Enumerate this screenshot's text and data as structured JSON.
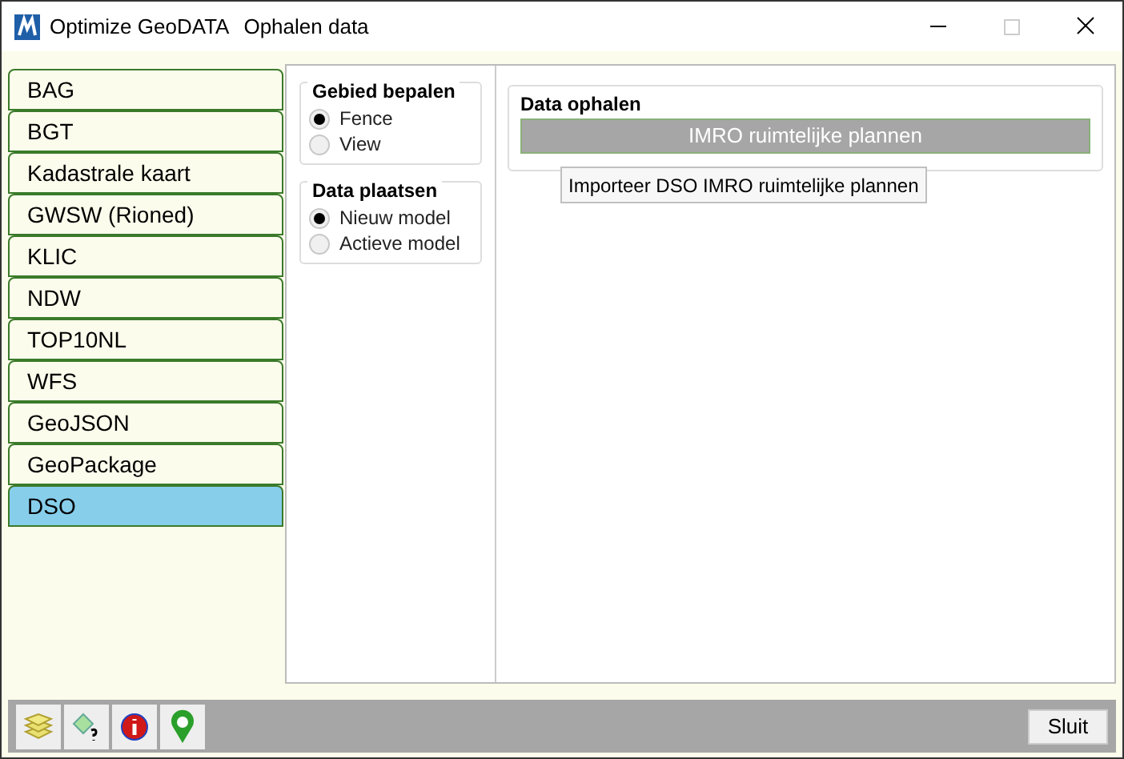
{
  "window": {
    "title": "Optimize GeoDATA",
    "subtitle": "Ophalen data"
  },
  "sidebar": {
    "items": [
      {
        "label": "BAG",
        "selected": false
      },
      {
        "label": "BGT",
        "selected": false
      },
      {
        "label": "Kadastrale kaart",
        "selected": false
      },
      {
        "label": "GWSW (Rioned)",
        "selected": false
      },
      {
        "label": "KLIC",
        "selected": false
      },
      {
        "label": "NDW",
        "selected": false
      },
      {
        "label": "TOP10NL",
        "selected": false
      },
      {
        "label": "WFS",
        "selected": false
      },
      {
        "label": "GeoJSON",
        "selected": false
      },
      {
        "label": "GeoPackage",
        "selected": false
      },
      {
        "label": "DSO",
        "selected": true
      }
    ]
  },
  "groups": [
    {
      "title": "Gebied bepalen",
      "options": [
        {
          "label": "Fence",
          "selected": true
        },
        {
          "label": "View",
          "selected": false
        }
      ]
    },
    {
      "title": "Data plaatsen",
      "options": [
        {
          "label": "Nieuw model",
          "selected": true
        },
        {
          "label": "Actieve model",
          "selected": false
        }
      ]
    }
  ],
  "data_ophalen": {
    "title": "Data ophalen",
    "button": {
      "label": "IMRO ruimtelijke plannen",
      "disabled": true
    },
    "tooltip": "Importeer DSO IMRO ruimtelijke plannen"
  },
  "footer": {
    "close_button": "Sluit"
  }
}
